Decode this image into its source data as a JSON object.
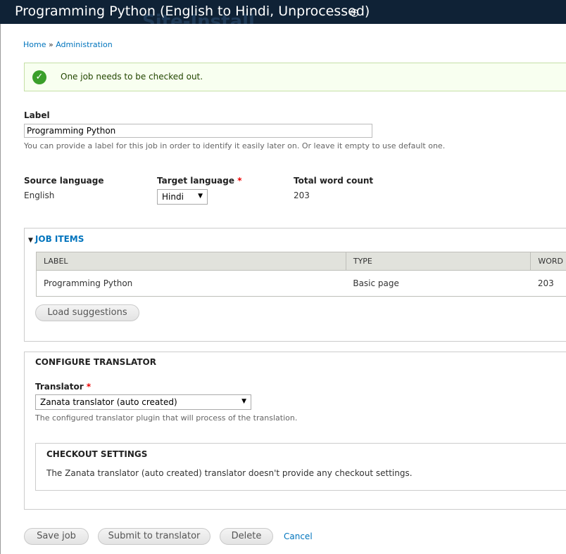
{
  "header": {
    "title": "Programming Python (English to Hindi, Unprocessed)",
    "background_text": "Site-Install"
  },
  "breadcrumb": {
    "home": "Home",
    "separator": "»",
    "admin": "Administration"
  },
  "message": {
    "text": "One job needs to be checked out."
  },
  "label_field": {
    "label": "Label",
    "value": "Programming Python",
    "description": "You can provide a label for this job in order to identify it easily later on. Or leave it empty to use default one."
  },
  "source_language": {
    "label": "Source language",
    "value": "English"
  },
  "target_language": {
    "label": "Target language",
    "required": "*",
    "selected": "Hindi"
  },
  "word_count": {
    "label": "Total word count",
    "value": "203"
  },
  "job_items": {
    "legend": "JOB ITEMS",
    "columns": [
      "LABEL",
      "TYPE",
      "WORD"
    ],
    "rows": [
      {
        "label": "Programming Python",
        "type": "Basic page",
        "words": "203"
      }
    ],
    "load_button": "Load suggestions"
  },
  "configure": {
    "title": "CONFIGURE TRANSLATOR",
    "translator_label": "Translator",
    "required": "*",
    "translator_selected": "Zanata translator (auto created)",
    "translator_desc": "The configured translator plugin that will process of the translation.",
    "checkout_title": "CHECKOUT SETTINGS",
    "checkout_text": "The Zanata translator (auto created) translator doesn't provide any checkout settings."
  },
  "actions": {
    "save": "Save job",
    "submit": "Submit to translator",
    "delete": "Delete",
    "cancel": "Cancel"
  },
  "colors": {
    "header_bg": "#0f2236",
    "link": "#0074bd",
    "message_bg": "#f8fff0",
    "success_icon": "#3a9f2a"
  },
  "icons": {
    "shortcut": "add-shortcut-icon",
    "success": "check-circle-icon",
    "collapse": "triangle-down-icon",
    "dropdown": "chevron-down-icon"
  }
}
